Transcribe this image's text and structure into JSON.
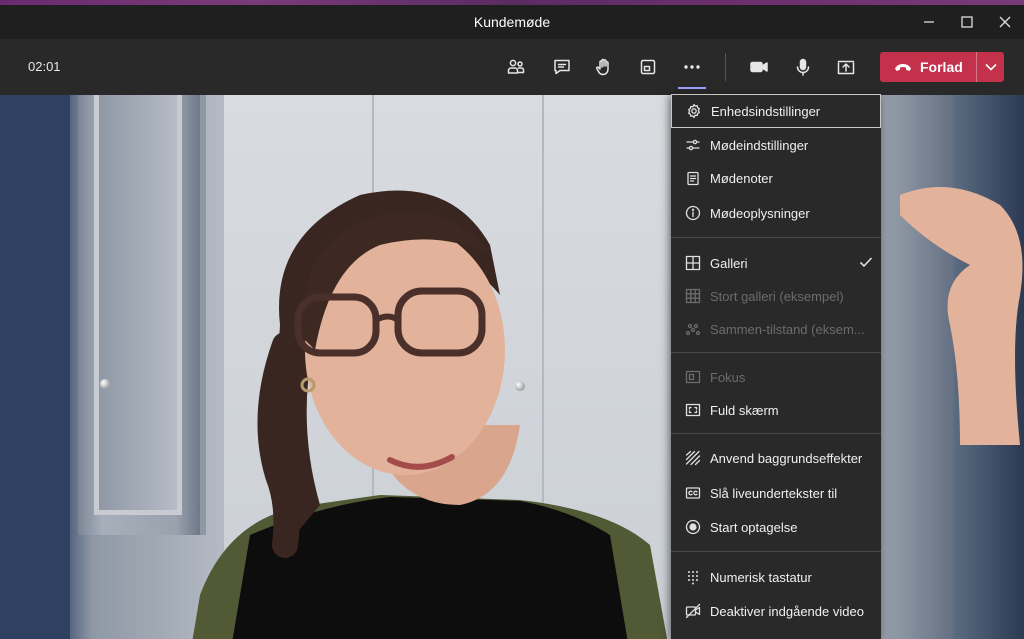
{
  "window": {
    "title": "Kundemøde"
  },
  "toolbar": {
    "timer": "02:01",
    "buttons": [
      {
        "name": "participants-icon"
      },
      {
        "name": "chat-icon"
      },
      {
        "name": "raise-hand-icon"
      },
      {
        "name": "rooms-icon"
      },
      {
        "name": "more-actions-icon"
      },
      {
        "name": "camera-icon"
      },
      {
        "name": "microphone-icon"
      },
      {
        "name": "share-screen-icon"
      }
    ],
    "leave_label": "Forlad",
    "leave_color": "#c4314b"
  },
  "menu": {
    "items": [
      {
        "label": "Enhedsindstillinger",
        "icon": "gear-icon",
        "focused": true
      },
      {
        "label": "Mødeindstillinger",
        "icon": "sliders-icon"
      },
      {
        "label": "Mødenoter",
        "icon": "notes-icon"
      },
      {
        "label": "Mødeoplysninger",
        "icon": "info-icon"
      },
      {
        "label": "Galleri",
        "icon": "gallery-icon",
        "checked": true
      },
      {
        "label": "Stort galleri (eksempel)",
        "icon": "large-gallery-icon",
        "disabled": true
      },
      {
        "label": "Sammen-tilstand (eksem...",
        "icon": "together-mode-icon",
        "disabled": true
      },
      {
        "label": "Fokus",
        "icon": "focus-icon",
        "disabled": true
      },
      {
        "label": "Fuld skærm",
        "icon": "fullscreen-icon"
      },
      {
        "label": "Anvend baggrundseffekter",
        "icon": "background-effects-icon"
      },
      {
        "label": "Slå liveundertekster til",
        "icon": "captions-icon"
      },
      {
        "label": "Start optagelse",
        "icon": "record-icon"
      },
      {
        "label": "Numerisk tastatur",
        "icon": "keypad-icon"
      },
      {
        "label": "Deaktiver indgående video",
        "icon": "video-off-icon"
      }
    ]
  }
}
